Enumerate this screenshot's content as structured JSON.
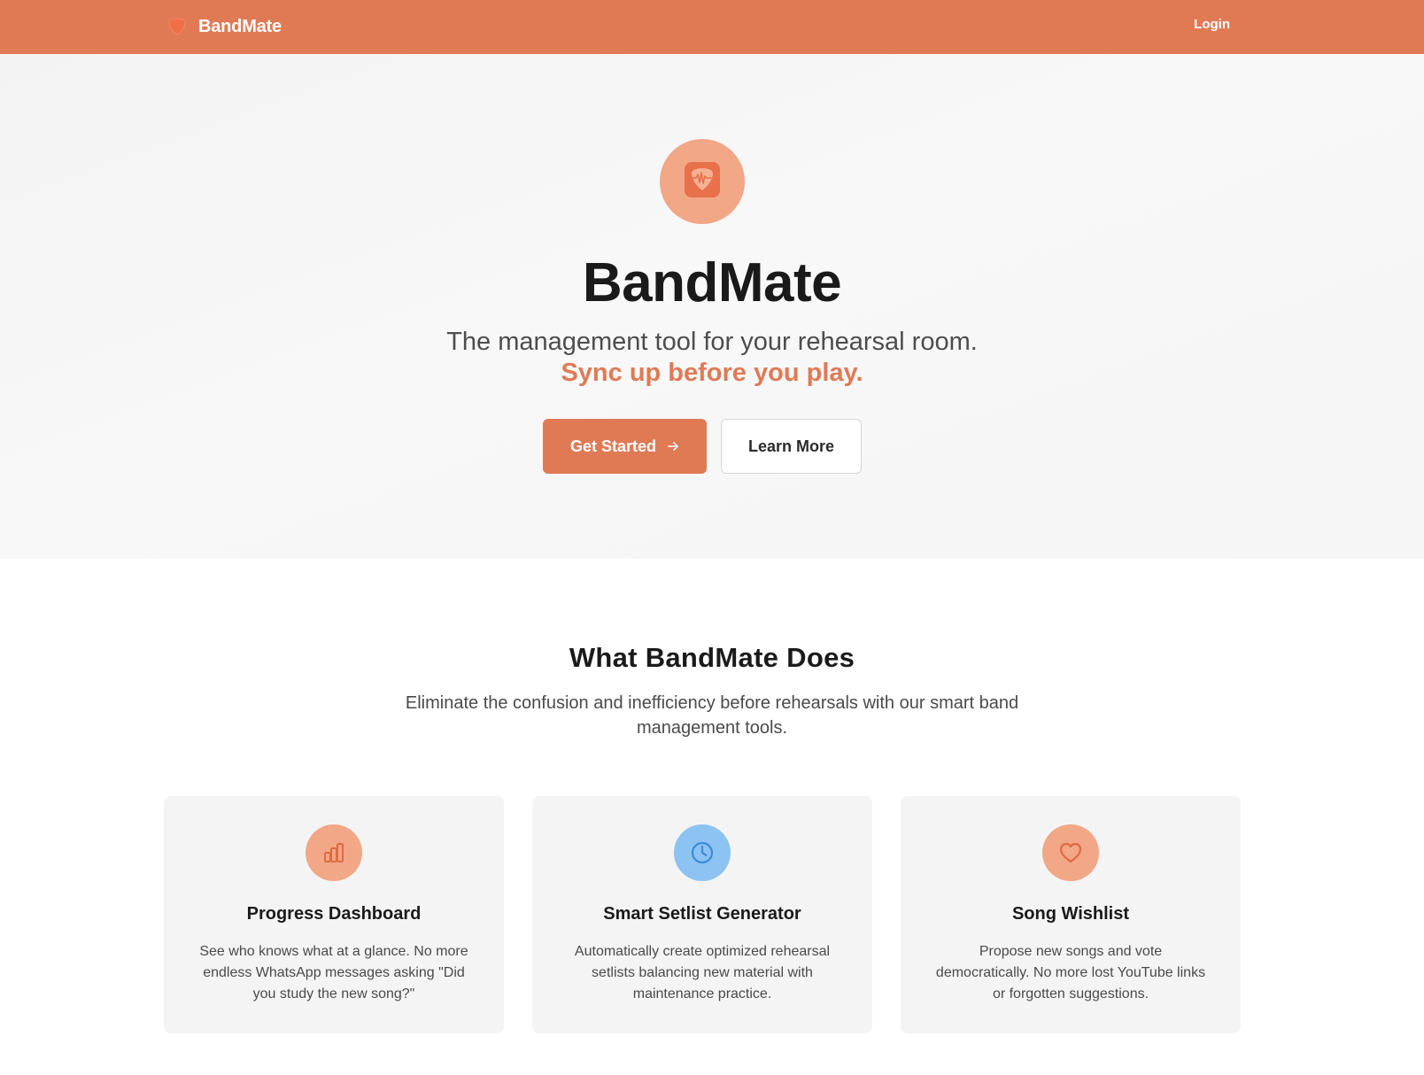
{
  "colors": {
    "brand": "#e07a55",
    "hero_logo_bg": "#f2a786",
    "hero_logo_fg": "#e8704a",
    "orange_icon_bg": "#f2a786",
    "blue_icon_bg": "#8cc3f2",
    "blue_icon_fg": "#3c8ad8"
  },
  "navbar": {
    "brand_icon": "guitar-pick-icon",
    "brand_name": "BandMate",
    "login_label": "Login"
  },
  "hero": {
    "logo_icon": "guitar-pick-heartbeat-icon",
    "title": "BandMate",
    "subtitle": "The management tool for your rehearsal room.",
    "tagline": "Sync up before you play.",
    "primary_button": "Get Started",
    "primary_button_icon": "arrow-right-icon",
    "secondary_button": "Learn More"
  },
  "features": {
    "title": "What BandMate Does",
    "description": "Eliminate the confusion and inefficiency before rehearsals with our smart band management tools.",
    "cards": [
      {
        "icon": "bar-chart-icon",
        "title": "Progress Dashboard",
        "text": "See who knows what at a glance. No more endless WhatsApp messages asking \"Did you study the new song?\""
      },
      {
        "icon": "clock-icon",
        "title": "Smart Setlist Generator",
        "text": "Automatically create optimized rehearsal setlists balancing new material with maintenance practice."
      },
      {
        "icon": "heart-icon",
        "title": "Song Wishlist",
        "text": "Propose new songs and vote democratically. No more lost YouTube links or forgotten suggestions."
      }
    ]
  }
}
